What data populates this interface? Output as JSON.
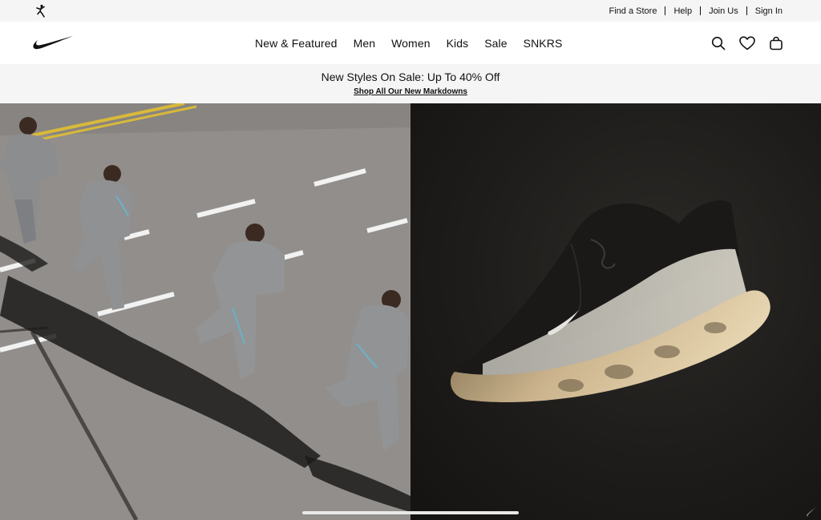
{
  "utility": {
    "logo_icon": "jordan-jumpman-icon",
    "links": [
      "Find a Store",
      "Help",
      "Join Us",
      "Sign In"
    ]
  },
  "nav": {
    "logo_icon": "nike-swoosh-icon",
    "links": [
      "New & Featured",
      "Men",
      "Women",
      "Kids",
      "Sale",
      "SNKRS"
    ],
    "icons": [
      "search-icon",
      "heart-icon",
      "bag-icon"
    ]
  },
  "promo": {
    "title": "New Styles On Sale: Up To 40% Off",
    "link": "Shop All Our New Markdowns"
  },
  "hero": {
    "left_image": "runners-on-road-photo",
    "right_image": "sneaker-on-dark-background-photo"
  },
  "colors": {
    "utility_bg": "#f5f5f5",
    "promo_bg": "#f5f5f5",
    "text": "#111111",
    "road": "#8f8c89",
    "dark_bg": "#1e1c1a"
  }
}
